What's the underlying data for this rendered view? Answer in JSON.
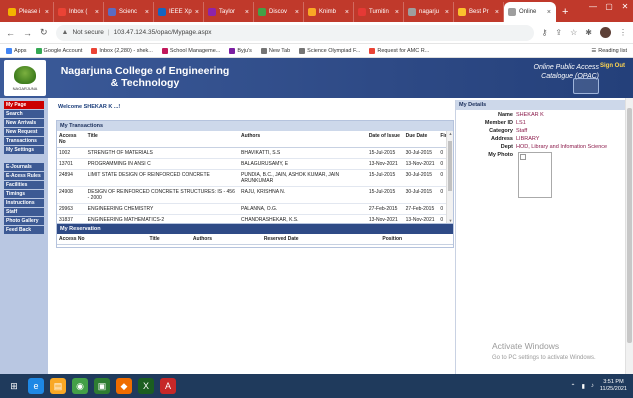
{
  "browser": {
    "tabs": [
      {
        "label": "Please i",
        "color": "#f4b400"
      },
      {
        "label": "Inbox (",
        "color": "#ea4335"
      },
      {
        "label": "Scienc",
        "color": "#5c6bc0"
      },
      {
        "label": "IEEE Xp",
        "color": "#1565c0"
      },
      {
        "label": "Taylor",
        "color": "#8e24aa"
      },
      {
        "label": "Discov",
        "color": "#43a047"
      },
      {
        "label": "Knimb",
        "color": "#f9a825"
      },
      {
        "label": "Turnitin",
        "color": "#e53935"
      },
      {
        "label": "nagarju",
        "color": "#9e9e9e"
      },
      {
        "label": "Best Pr",
        "color": "#fbc02d"
      },
      {
        "label": "Online",
        "color": "#9e9e9e"
      }
    ],
    "new_tab": "+",
    "controls": {
      "minimize": "—",
      "maximize": "▢",
      "close": "✕"
    },
    "security_label": "Not secure",
    "url": "103.47.124.35/opac/Mypage.aspx",
    "reading_list": "Reading list",
    "bookmarks": [
      {
        "label": "Apps",
        "color": "#4285f4"
      },
      {
        "label": "Google Account",
        "color": "#34a853"
      },
      {
        "label": "Inbox (2,280) - shek...",
        "color": "#ea4335"
      },
      {
        "label": "School Manageme...",
        "color": "#c2185b"
      },
      {
        "label": "Byju's",
        "color": "#7b1fa2"
      },
      {
        "label": "New Tab",
        "color": "#757575"
      },
      {
        "label": "Science Olympiad F...",
        "color": "#757575"
      },
      {
        "label": "Request for AMC R...",
        "color": "#ea4335"
      }
    ]
  },
  "header": {
    "logo_text": "NAGARJUNA",
    "college_name": "Nagarjuna College of Engineering & Technology",
    "catalogue_line1": "Online Public Access",
    "catalogue_line2": "Catalogue (OPAC)",
    "sign_out": "Sign Out"
  },
  "menu": {
    "group1": [
      "My Page",
      "Search",
      "New Arrivals",
      "New Request",
      "Transactions",
      "My Settings"
    ],
    "group2": [
      "E-Journals",
      "E-Acess Rules",
      "Facilities",
      "Timings",
      "Instructions",
      "Staff",
      "Photo Gallery",
      "Feed Back"
    ]
  },
  "welcome": "Welcome SHEKAR K ...!",
  "transactions": {
    "title": "My Transactions",
    "columns": [
      "Access No",
      "Title",
      "Authors",
      "Date of Issue",
      "Due Date",
      "Fine"
    ],
    "rows": [
      [
        "1002",
        "STRENGTH OF MATERIALS",
        "BHAVIKATTI, S.S",
        "15-Jul-2015",
        "30-Jul-2015",
        "0"
      ],
      [
        "13701",
        "PROGRAMMING IN ANSI C",
        "BALAGURUSAMY, E",
        "13-Nov-2021",
        "13-Nov-2021",
        "0"
      ],
      [
        "24894",
        "LIMIT STATE DESIGN OF REINFORCED CONCRETE",
        "PUNDIA, B.C., JAIN, ASHOK KUMAR, JAIN ARUNKUMAR",
        "15-Jul-2015",
        "30-Jul-2015",
        "0"
      ],
      [
        "24908",
        "DESIGN OF REINFORCED CONCRETE STRUCTURES: IS - 456 - 2000",
        "RAJU, KRISHNA N.",
        "15-Jul-2015",
        "30-Jul-2015",
        "0"
      ],
      [
        "29963",
        "ENGINEERING CHEMISTRY",
        "PALANNA, O.G.",
        "27-Feb-2015",
        "27-Feb-2015",
        "0"
      ],
      [
        "31837",
        "ENGINEERING MATHEMATICS-2",
        "CHANDRASHEKAR, K.S.",
        "13-Nov-2021",
        "13-Nov-2021",
        "0"
      ]
    ]
  },
  "reservation": {
    "title": "My Reservation",
    "columns": [
      "Access No",
      "Title",
      "Authors",
      "Reserved Date",
      "Position"
    ]
  },
  "details": {
    "title": "My Details",
    "fields": [
      {
        "label": "Name",
        "value": "SHEKAR K"
      },
      {
        "label": "Member ID",
        "value": "LS1"
      },
      {
        "label": "Category",
        "value": "Staff"
      },
      {
        "label": "Address",
        "value": "LIBRARY"
      },
      {
        "label": "Dept",
        "value": "HOD, Library and Infomation Science"
      }
    ],
    "photo_label": "My Photo"
  },
  "watermark": {
    "line1": "Activate Windows",
    "line2": "Go to PC settings to activate Windows."
  },
  "taskbar": {
    "apps": [
      {
        "icon": "windows-icon",
        "glyph": "⊞",
        "color": "#1f3a5c"
      },
      {
        "icon": "internet-explorer-icon",
        "glyph": "e",
        "color": "#1e88e5"
      },
      {
        "icon": "file-explorer-icon",
        "glyph": "▤",
        "color": "#f9a825"
      },
      {
        "icon": "chrome-icon",
        "glyph": "◉",
        "color": "#43a047"
      },
      {
        "icon": "tablet-app-icon",
        "glyph": "▣",
        "color": "#2e7d32"
      },
      {
        "icon": "maps-icon",
        "glyph": "◆",
        "color": "#ef6c00"
      },
      {
        "icon": "excel-icon",
        "glyph": "X",
        "color": "#1b5e20"
      },
      {
        "icon": "pdf-icon",
        "glyph": "A",
        "color": "#c62828"
      }
    ],
    "time": "3:51 PM",
    "date": "11/25/2021"
  }
}
